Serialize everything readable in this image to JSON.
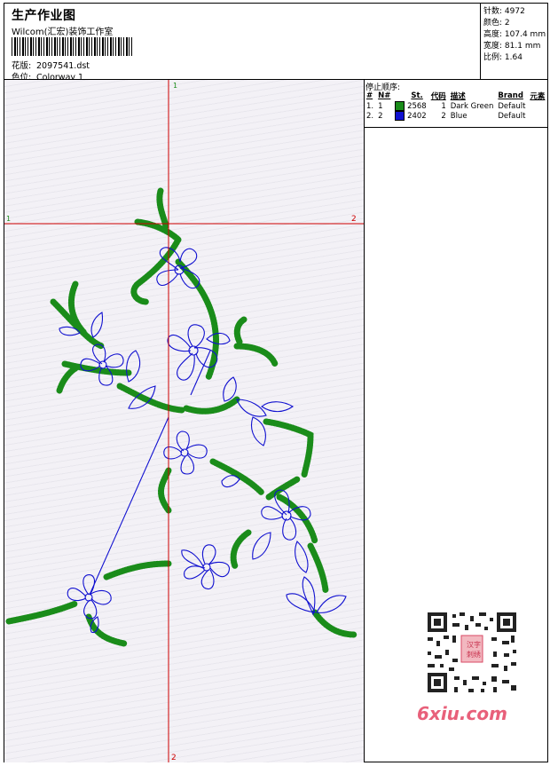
{
  "header": {
    "title": "生产作业图",
    "company": "Wilcom(汇宏)装饰工作室",
    "pattern_label": "花版:",
    "pattern_value": "2097541.dst",
    "colorway_label": "色位:",
    "colorway_value": "Colorway 1"
  },
  "stats": [
    {
      "label": "针数:",
      "value": "4972"
    },
    {
      "label": "颜色:",
      "value": "2"
    },
    {
      "label": "高度:",
      "value": "107.4 mm"
    },
    {
      "label": "宽度:",
      "value": "81.1 mm"
    },
    {
      "label": "比例:",
      "value": "1.64"
    }
  ],
  "canvas": {
    "axis_top": "1",
    "axis_bottom": "2",
    "axis_left": "1",
    "axis_right": "2",
    "crosshair_color": "#cc0000",
    "thread_colors": {
      "green": "#1a8c1a",
      "blue": "#1010d0"
    }
  },
  "stop_sequence": {
    "heading": "停止顺序:",
    "columns": [
      "#",
      "N#",
      "St.",
      "代码",
      "描述",
      "Brand",
      "元素"
    ],
    "rows": [
      {
        "idx": "1.",
        "n": "1",
        "color": "#1a8c1a",
        "st": "2568",
        "code": "1",
        "desc": "Dark Green",
        "brand": "Default"
      },
      {
        "idx": "2.",
        "n": "2",
        "color": "#1010d0",
        "st": "2402",
        "code": "2",
        "desc": "Blue",
        "brand": "Default"
      }
    ]
  },
  "watermark": {
    "stamp_text": "汉字刺绣",
    "logo_text": "6xiu.com"
  }
}
